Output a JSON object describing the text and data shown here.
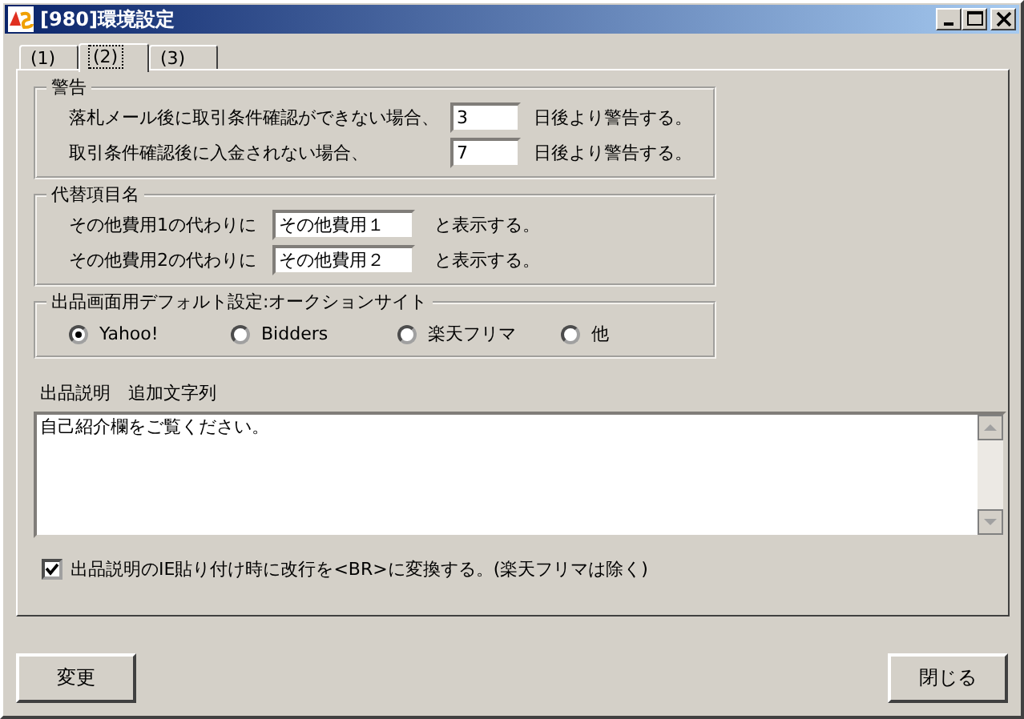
{
  "window": {
    "title": "[980]環境設定"
  },
  "tabs": [
    {
      "label": "(1)",
      "selected": false
    },
    {
      "label": "(2)",
      "selected": true
    },
    {
      "label": "(3)",
      "selected": false
    }
  ],
  "warning_group": {
    "title": "警告",
    "rows": [
      {
        "label": "落札メール後に取引条件確認ができない場合、",
        "value": "3",
        "suffix": "日後より警告する。"
      },
      {
        "label": "取引条件確認後に入金されない場合、",
        "value": "7",
        "suffix": "日後より警告する。"
      }
    ]
  },
  "alias_group": {
    "title": "代替項目名",
    "rows": [
      {
        "label": "その他費用1の代わりに",
        "value": "その他費用１",
        "suffix": "と表示する。"
      },
      {
        "label": "その他費用2の代わりに",
        "value": "その他費用２",
        "suffix": "と表示する。"
      }
    ]
  },
  "default_site_group": {
    "title": "出品画面用デフォルト設定:オークションサイト",
    "options": [
      {
        "label": "Yahoo!",
        "selected": true
      },
      {
        "label": "Bidders",
        "selected": false
      },
      {
        "label": "楽天フリマ",
        "selected": false
      },
      {
        "label": "他",
        "selected": false
      }
    ]
  },
  "description": {
    "label": "出品説明　追加文字列",
    "value": "自己紹介欄をご覧ください。"
  },
  "convert_br": {
    "label": "出品説明のIE貼り付け時に改行を<BR>に変換する。(楽天フリマは除く)",
    "checked": true
  },
  "buttons": [
    {
      "label": "変更"
    },
    {
      "label": "閉じる"
    }
  ]
}
